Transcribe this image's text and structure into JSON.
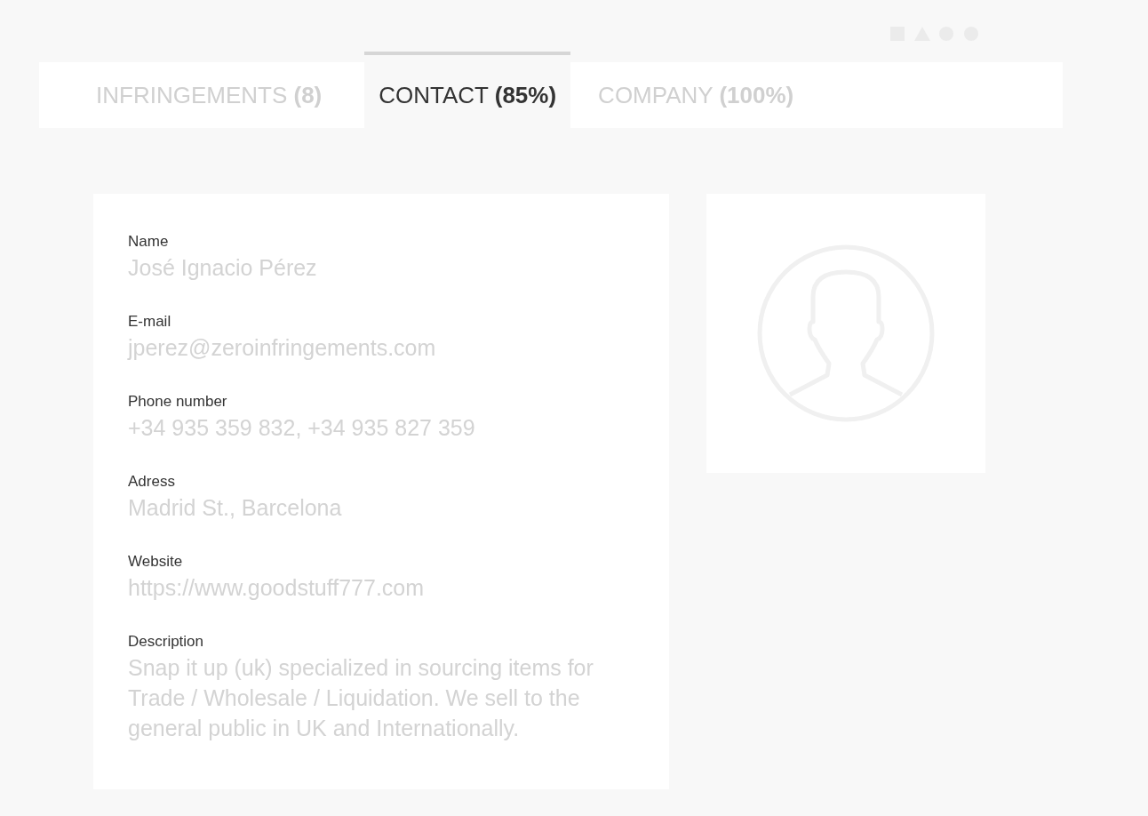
{
  "tabs": [
    {
      "label": "INFRINGEMENTS",
      "count": "(8)",
      "selected": false
    },
    {
      "label": "CONTACT",
      "count": "(85%)",
      "selected": true
    },
    {
      "label": "COMPANY",
      "count": "(100%)",
      "selected": false
    }
  ],
  "fields": [
    {
      "label": "Name",
      "value": "José Ignacio Pérez"
    },
    {
      "label": "E-mail",
      "value": "jperez@zeroinfringements.com"
    },
    {
      "label": "Phone number",
      "value": "+34 935 359 832, +34 935 827 359"
    },
    {
      "label": "Adress",
      "value": "Madrid St., Barcelona"
    },
    {
      "label": "Website",
      "value": "https://www.goodstuff777.com"
    },
    {
      "label": "Description",
      "value": "Snap it up (uk) specialized in sourcing items for Trade / Wholesale / Liquidation. We sell to the general public in UK and Internationally."
    }
  ]
}
